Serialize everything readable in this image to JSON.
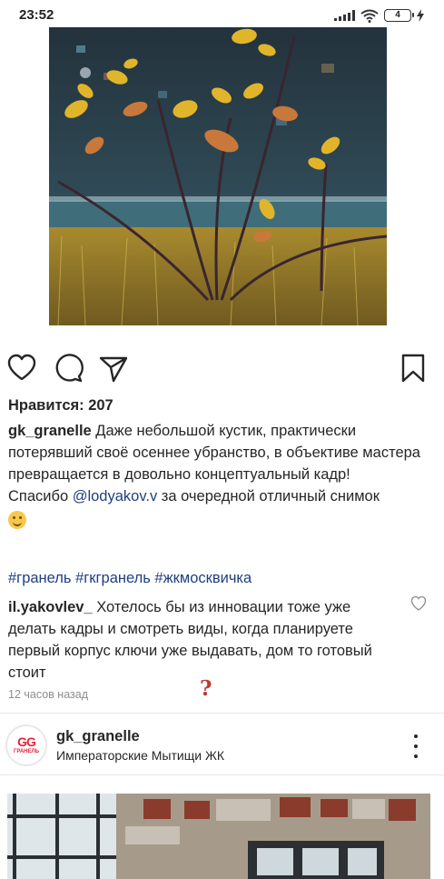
{
  "status_bar": {
    "time": "23:52",
    "battery": "4",
    "icons": [
      "signal-icon",
      "wifi-icon",
      "battery-icon",
      "charging-icon"
    ]
  },
  "post": {
    "image_description_icon": "photo",
    "actions": [
      "like-icon",
      "comment-icon",
      "share-icon",
      "bookmark-icon"
    ],
    "likes": "Нравится: 207",
    "caption": {
      "username": "gk_granelle",
      "text_line1": " Даже небольшой кустик, практически потерявший своё осеннее убранство, в объективе мастера превращается в довольно концептуальный кадр!",
      "thanks_prefix": "Спасибо ",
      "mention": "@lodyakov.v",
      "thanks_suffix": " за очередной отличный снимок"
    },
    "hashtags": "#гранель #гкгранель #жкмосквичка",
    "comment": {
      "username": "il.yakovlev_",
      "text": " Хотелось бы из инновации тоже уже делать кадры и смотреть виды, когда планируете первый корпус ключи уже выдавать, дом то готовый стоит"
    },
    "time_ago": "12 часов назад",
    "annotation": "?"
  },
  "next_post": {
    "username": "gk_granelle",
    "location": "Императорские Мытищи ЖК",
    "avatar_text": "GG",
    "avatar_brand": "ГРАНЕЛЬ"
  },
  "colors": {
    "text": "#262626",
    "link": "#1e3f80",
    "secondary": "#8e8e8e",
    "brand": "#e0243c"
  }
}
